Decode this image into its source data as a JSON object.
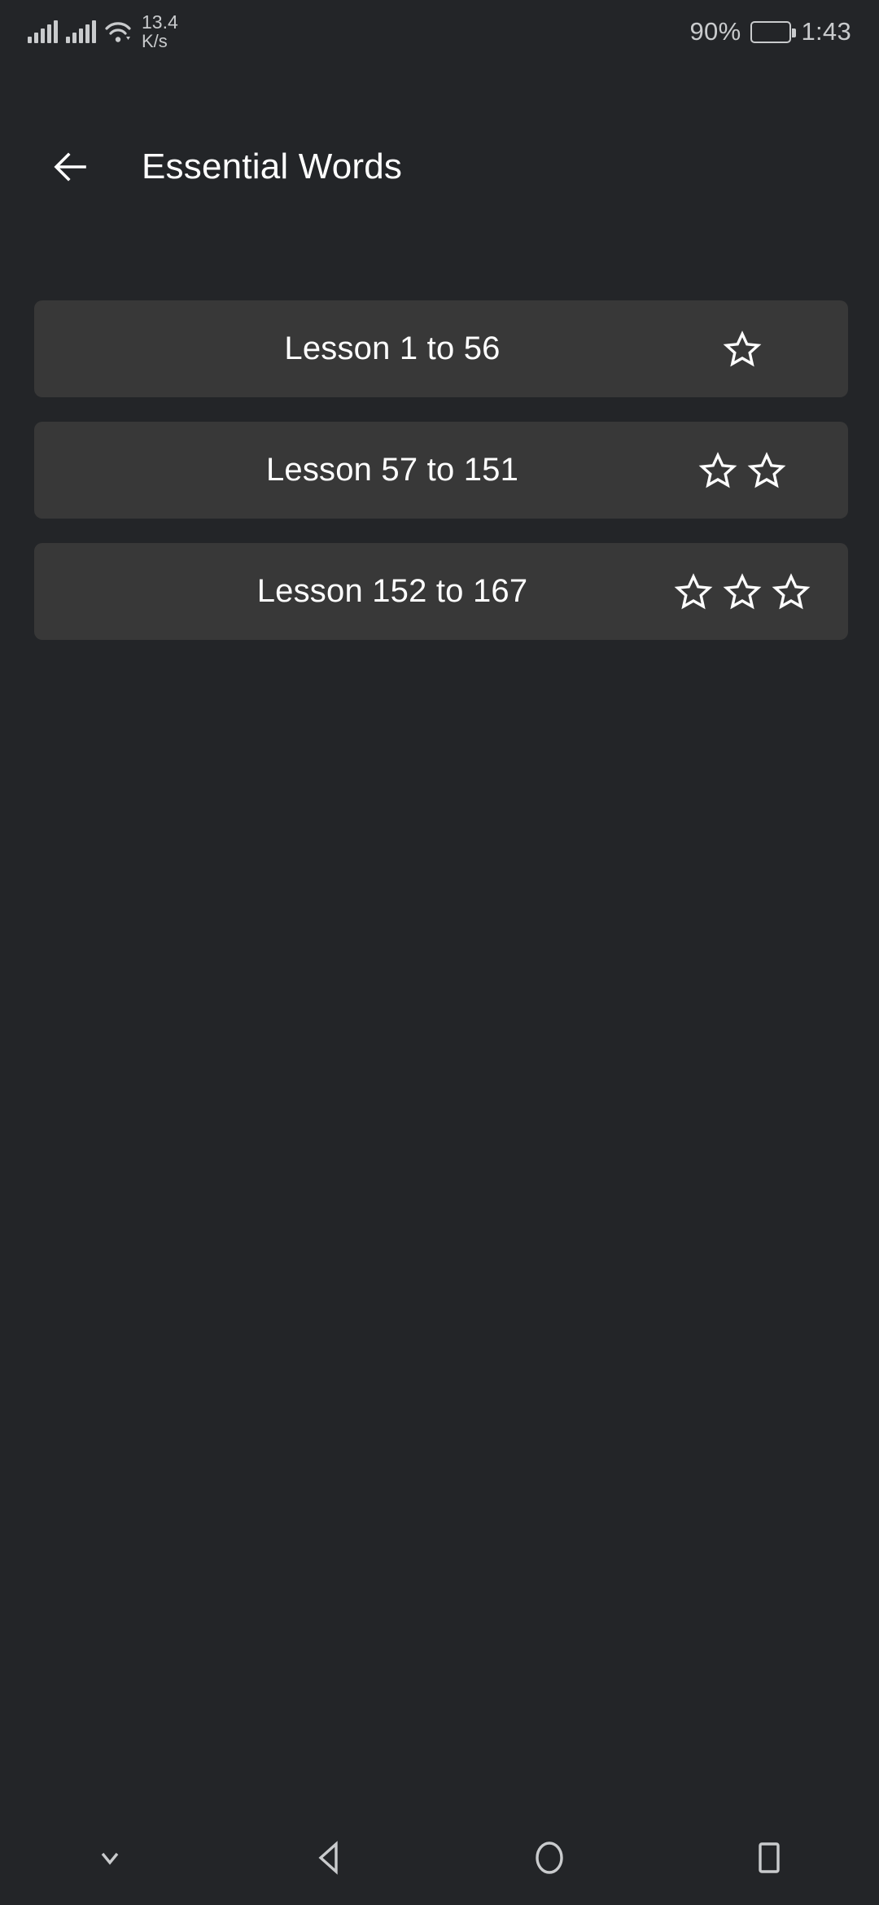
{
  "status_bar": {
    "signal_icons": [
      "signal-bars-sim1",
      "signal-bars-sim2"
    ],
    "wifi_icon": "wifi-icon",
    "network_speed_value": "13.4",
    "network_speed_unit": "K/s",
    "battery_percent": "90%",
    "battery_icon": "battery-icon",
    "time": "1:43"
  },
  "app_bar": {
    "back_icon": "back-arrow-icon",
    "title": "Essential Words"
  },
  "lessons": [
    {
      "label": "Lesson 1 to 56",
      "stars": 1
    },
    {
      "label": "Lesson 57 to 151",
      "stars": 2
    },
    {
      "label": "Lesson 152 to 167",
      "stars": 3
    }
  ],
  "nav_bar": {
    "buttons": [
      {
        "icon": "chevron-down-icon",
        "name": "hide-navbar-button"
      },
      {
        "icon": "back-triangle-icon",
        "name": "android-back-button"
      },
      {
        "icon": "home-circle-icon",
        "name": "android-home-button"
      },
      {
        "icon": "recents-square-icon",
        "name": "android-recents-button"
      }
    ]
  },
  "colors": {
    "page_background": "#232528",
    "card_background": "#383838",
    "primary_text": "#ffffff",
    "status_text": "#c9cbcd"
  }
}
